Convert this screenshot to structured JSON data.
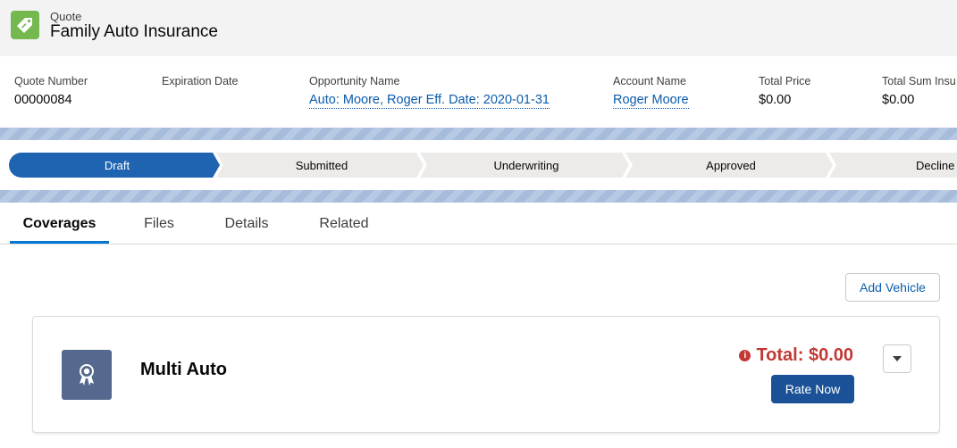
{
  "header": {
    "object_label": "Quote",
    "title": "Family Auto Insurance",
    "icon": "price-tag-icon",
    "icon_color": "#75b84f"
  },
  "highlights": [
    {
      "label": "Quote Number",
      "value": "00000084",
      "link": false
    },
    {
      "label": "Expiration Date",
      "value": "",
      "link": false
    },
    {
      "label": "Opportunity Name",
      "value": "Auto: Moore, Roger Eff. Date: 2020-01-31",
      "link": true
    },
    {
      "label": "Account Name",
      "value": "Roger Moore",
      "link": true
    },
    {
      "label": "Total Price",
      "value": "$0.00",
      "link": false
    },
    {
      "label": "Total Sum Insu",
      "value": "$0.00",
      "link": false
    }
  ],
  "path": {
    "stages": [
      "Draft",
      "Submitted",
      "Underwriting",
      "Approved",
      "Decline"
    ],
    "active_index": 0,
    "active_color": "#1f64b1",
    "inactive_color": "#ecebea"
  },
  "tabs": [
    "Coverages",
    "Files",
    "Details",
    "Related"
  ],
  "active_tab": 0,
  "actions": {
    "add_vehicle": "Add Vehicle"
  },
  "product_card": {
    "name": "Multi Auto",
    "icon": "award-icon",
    "total_label": "Total: $0.00",
    "rate_now": "Rate Now",
    "warning_icon": "info-icon"
  }
}
